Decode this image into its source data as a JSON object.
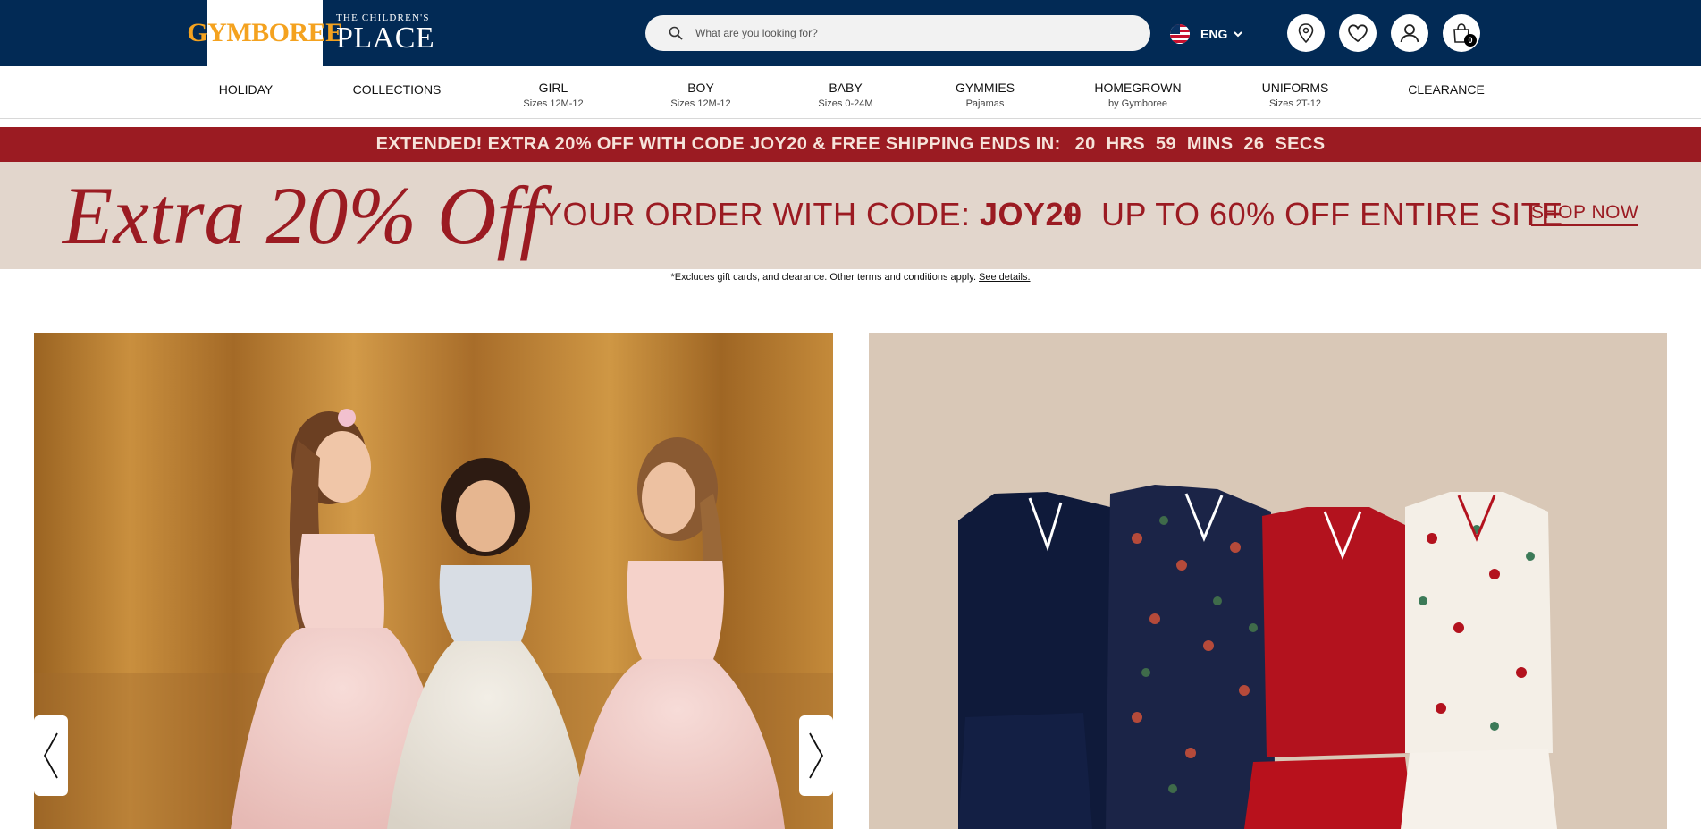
{
  "header": {
    "brand_primary": "GYMBOREE",
    "brand_secondary_small": "THE CHILDREN'S",
    "brand_secondary_big": "PLACE",
    "search_placeholder": "What are you looking for?",
    "language": "ENG",
    "cart_count": "0",
    "colors": {
      "header_bg": "#022a55",
      "logo_orange": "#f4a21f"
    }
  },
  "nav": {
    "items": [
      {
        "label": "HOLIDAY",
        "sub": ""
      },
      {
        "label": "COLLECTIONS",
        "sub": ""
      },
      {
        "label": "GIRL",
        "sub": "Sizes 12M-12"
      },
      {
        "label": "BOY",
        "sub": "Sizes 12M-12"
      },
      {
        "label": "BABY",
        "sub": "Sizes 0-24M"
      },
      {
        "label": "GYMMIES",
        "sub": "Pajamas"
      },
      {
        "label": "HOMEGROWN",
        "sub": "by Gymboree"
      },
      {
        "label": "UNIFORMS",
        "sub": "Sizes 2T-12"
      },
      {
        "label": "CLEARANCE",
        "sub": ""
      }
    ]
  },
  "promo": {
    "countdown_text": "EXTENDED! EXTRA 20% OFF WITH CODE JOY20 & FREE SHIPPING ENDS IN:",
    "countdown_time": "20  HRS  59  MINS  26  SECS",
    "headline": "Extra 20% Off",
    "code_prefix": "YOUR ORDER WITH CODE: ",
    "code": "JOY20",
    "plus": "+",
    "secondary": "UP TO 60% OFF ENTIRE SITE",
    "cta": "SHOP NOW",
    "disclaimer": "*Excludes gift cards, and clearance. Other terms and conditions apply.",
    "disclaimer_link": "See details.",
    "colors": {
      "promo_red": "#9b1b22",
      "banner_bg": "#e2d6cc"
    }
  },
  "hero": {
    "prev_icon": "chevron-left-icon",
    "next_icon": "chevron-right-icon"
  }
}
